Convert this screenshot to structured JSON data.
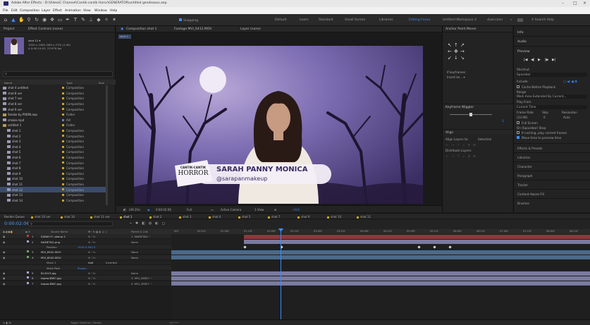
{
  "window": {
    "title": "Adobe After Effects - D:\\Video\\C Channel\\Cantik-cantik Horor\\GENERATOR\\untitled gendeaous.aep",
    "controls": [
      "–",
      "□",
      "×"
    ]
  },
  "menu": [
    "File",
    "Edit",
    "Composition",
    "Layer",
    "Effect",
    "Animation",
    "View",
    "Window",
    "Help"
  ],
  "toolbar": {
    "tools": [
      "home-icon",
      "selection-icon",
      "hand-icon",
      "zoom-icon",
      "rotate-icon",
      "camera-icon",
      "pan-behind-icon",
      "mask-icon",
      "pen-icon",
      "type-icon",
      "brush-icon",
      "clone-icon",
      "eraser-icon",
      "roto-icon",
      "puppet-icon"
    ],
    "snapping": "Snapping",
    "workspaces": [
      "Default",
      "Learn",
      "Standard",
      "Small Screen",
      "Libraries",
      "Editing Fxxxx",
      "Untitled Workspace 2",
      "dual.conn"
    ],
    "active_workspace": "Editing Fxxxx",
    "search": "Search Help"
  },
  "project": {
    "tabs": [
      "Project",
      "Effect Controls (none)"
    ],
    "selected_name": "shot 12 ▾",
    "info_lines": [
      "1920 x 1080 (960 x 270) (1.00)",
      "Δ 0:00:14:02, 23.976 fps"
    ],
    "columns": [
      "Name",
      "Type",
      "Size"
    ],
    "items": [
      {
        "name": "shot 4 untitled",
        "type": "Composition",
        "color": "#c9a227"
      },
      {
        "name": "shot 8 ver",
        "type": "Composition",
        "color": "#c9a227"
      },
      {
        "name": "shot 7 ver",
        "type": "Composition",
        "color": "#c9a227"
      },
      {
        "name": "shot 8 ver",
        "type": "Composition",
        "color": "#c9a227"
      },
      {
        "name": "shot 9 ver",
        "type": "Composition",
        "color": "#c9a227"
      },
      {
        "name": "Smoke by PIXON.aep",
        "type": "Folder",
        "color": "#c9a227"
      },
      {
        "name": "smoke.mp4",
        "type": "AVI",
        "color": "#7a7ab0"
      },
      {
        "name": "untitled 1",
        "type": "Folder",
        "color": "#c9a227"
      },
      {
        "name": "shot 1",
        "type": "Composition",
        "color": "#c9a227"
      },
      {
        "name": "shot 2",
        "type": "Composition",
        "color": "#c9a227"
      },
      {
        "name": "shot 3",
        "type": "Composition",
        "color": "#c9a227"
      },
      {
        "name": "shot 4",
        "type": "Composition",
        "color": "#c9a227"
      },
      {
        "name": "shot 5",
        "type": "Composition",
        "color": "#c9a227"
      },
      {
        "name": "shot 6",
        "type": "Composition",
        "color": "#c9a227"
      },
      {
        "name": "shot 7",
        "type": "Composition",
        "color": "#c9a227"
      },
      {
        "name": "shot 8",
        "type": "Composition",
        "color": "#c9a227"
      },
      {
        "name": "shot 9",
        "type": "Composition",
        "color": "#c9a227"
      },
      {
        "name": "shot 10",
        "type": "Composition",
        "color": "#c9a227"
      },
      {
        "name": "shot 11",
        "type": "Composition",
        "color": "#c9a227"
      },
      {
        "name": "shot 12",
        "type": "Composition",
        "color": "#c9a227",
        "selected": true
      },
      {
        "name": "shot 13",
        "type": "Composition",
        "color": "#c9a227"
      },
      {
        "name": "shot 14",
        "type": "Composition",
        "color": "#c9a227"
      }
    ],
    "bpc": "8 bpc"
  },
  "composition": {
    "tabs": [
      "Composition shot 1",
      "Footage MVI_6412.MOV",
      "Layer (none)"
    ],
    "flow_label": "shot 1",
    "lower_third": {
      "brand_top": "CANTIK-CANTIK",
      "brand_bottom": "HORROR",
      "name": "SARAH PANNY MONICA",
      "handle": "@sarapanmakeup"
    },
    "viewer_controls": [
      "(49.3%)",
      "0:00:02:06",
      "Full",
      "Active Camera",
      "1 View",
      "+0.0"
    ]
  },
  "anchor_panel": {
    "title": "Anchor Point Mover",
    "arrows": [
      "↖",
      "↑",
      "↗",
      "←",
      "✥",
      "→",
      "↙",
      "↓",
      "↘"
    ],
    "keyframes_label": "If keyframes:",
    "keyframes_value": "Insert ke... ▾"
  },
  "wiggler": {
    "title": "Keyframe Wiggler",
    "value": "1"
  },
  "align": {
    "title": "Align",
    "align_to": "Align Layers to:",
    "value": "Selection",
    "distribute": "Distribute Layers:"
  },
  "right_panel": {
    "items": [
      "Info",
      "Audio",
      "Preview"
    ],
    "preview_controls": [
      "|◀",
      "◀|",
      "▶",
      "|▶",
      "▶|"
    ],
    "shortcut_label": "Shortcut",
    "shortcut_value": "Spacebar",
    "include": "Include:",
    "cache_label": "Cache Before Playback",
    "range_label": "Range",
    "range_value": "Work Area Extended By Current...",
    "playfrom_label": "Play From",
    "playfrom_value": "Current Time",
    "framerate_label": "Frame Rate",
    "skip_label": "Skip",
    "resolution_label": "Resolution",
    "framerate_value": "(23.98)",
    "skip_value": "0",
    "resolution_value": "Auto",
    "fullscreen": "Full Screen",
    "onstop": "On (Spacebar) Stop:",
    "if_caching": "If caching, play cached frames",
    "move_time": "Move time to preview time",
    "panels": [
      "Effects & Presets",
      "Libraries",
      "Character",
      "Paragraph",
      "Tracker",
      "Content-Aware Fill",
      "Brushes"
    ]
  },
  "timeline": {
    "tabs": [
      "Render Queue",
      "shot 10 ver",
      "shot 10",
      "shot 11 ver",
      "shot 1",
      "shot 2",
      "shot 3",
      "shot 4",
      "shot 5",
      "shot 7",
      "shot 9",
      "shot 10",
      "shot 11"
    ],
    "active_tab": "shot 1",
    "timecode": "0:00:02:06",
    "columns": [
      "Source Name",
      "Mode",
      "Parent & Link"
    ],
    "ruler": [
      "00f",
      "00:12f",
      "01:00f",
      "01:12f",
      "02:00f",
      "02:12f",
      "03:00f",
      "03:12f",
      "04:00f",
      "04:12f",
      "05:00f",
      "05:12f",
      "06:00f",
      "06:12f",
      "07:00f",
      "07:12f",
      "08:00f",
      "08:12f"
    ],
    "layers": [
      {
        "num": "1",
        "name": "SARAH P...akeup 2",
        "color": "#c04040",
        "parent": "1. NAMETAG ~",
        "track": "#8a3a3a"
      },
      {
        "num": "2",
        "name": "NAMETAG.png",
        "color": "#a8a8d8",
        "parent": "None",
        "track": "#7a7aa0"
      },
      {
        "num": "",
        "name": "Position",
        "color": "",
        "parent": "",
        "track": ""
      },
      {
        "num": "3",
        "name": "MVI_6942.MOV",
        "color": "#6aa86a",
        "parent": "None",
        "track": "#4a6a8a"
      },
      {
        "num": "4",
        "name": "MVI_6942.MOV",
        "color": "#6aa86a",
        "parent": "None",
        "track": "#4a6a8a"
      },
      {
        "num": "",
        "name": "Mask 1",
        "color": "",
        "parent": "",
        "track": ""
      },
      {
        "num": "",
        "name": "Mask Path",
        "color": "",
        "parent": "",
        "track": ""
      },
      {
        "num": "5",
        "name": "814519.jpg",
        "color": "#a8a8d8",
        "parent": "None",
        "track": "#7a7aa0"
      },
      {
        "num": "6",
        "name": "topaw-BWC.jpg",
        "color": "#a8a8d8",
        "parent": "3. MVI_45827 ~",
        "track": "#7a7aa0"
      },
      {
        "num": "7",
        "name": "topaw-BWC.jpg",
        "color": "#a8a8d8",
        "parent": "4. MVI_45827 ~",
        "track": "#7a7aa0"
      }
    ],
    "position_value": "1034.5,942.5",
    "mode_add": "Add",
    "inverted": "Inverted",
    "shape": "Shape..."
  },
  "status": [
    "Toggle Switches / Modes"
  ]
}
